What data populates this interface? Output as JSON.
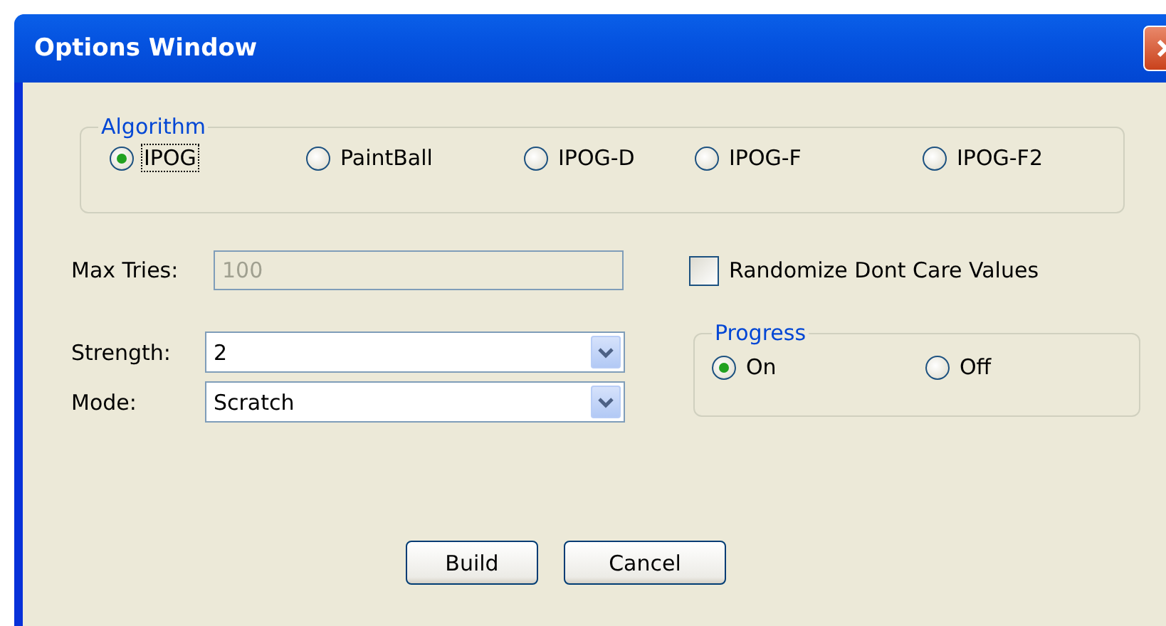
{
  "window": {
    "title": "Options Window"
  },
  "algorithm": {
    "label": "Algorithm",
    "options": [
      {
        "label": "IPOG",
        "selected": true
      },
      {
        "label": "PaintBall",
        "selected": false
      },
      {
        "label": "IPOG-D",
        "selected": false
      },
      {
        "label": "IPOG-F",
        "selected": false
      },
      {
        "label": "IPOG-F2",
        "selected": false
      }
    ]
  },
  "max_tries": {
    "label": "Max Tries:",
    "value": "100",
    "disabled": true
  },
  "randomize": {
    "label": "Randomize Dont Care Values",
    "checked": false
  },
  "strength": {
    "label": "Strength:",
    "value": "2"
  },
  "mode": {
    "label": "Mode:",
    "value": "Scratch"
  },
  "progress": {
    "label": "Progress",
    "options": [
      {
        "label": "On",
        "selected": true
      },
      {
        "label": "Off",
        "selected": false
      }
    ]
  },
  "buttons": [
    "Build",
    "Cancel"
  ]
}
